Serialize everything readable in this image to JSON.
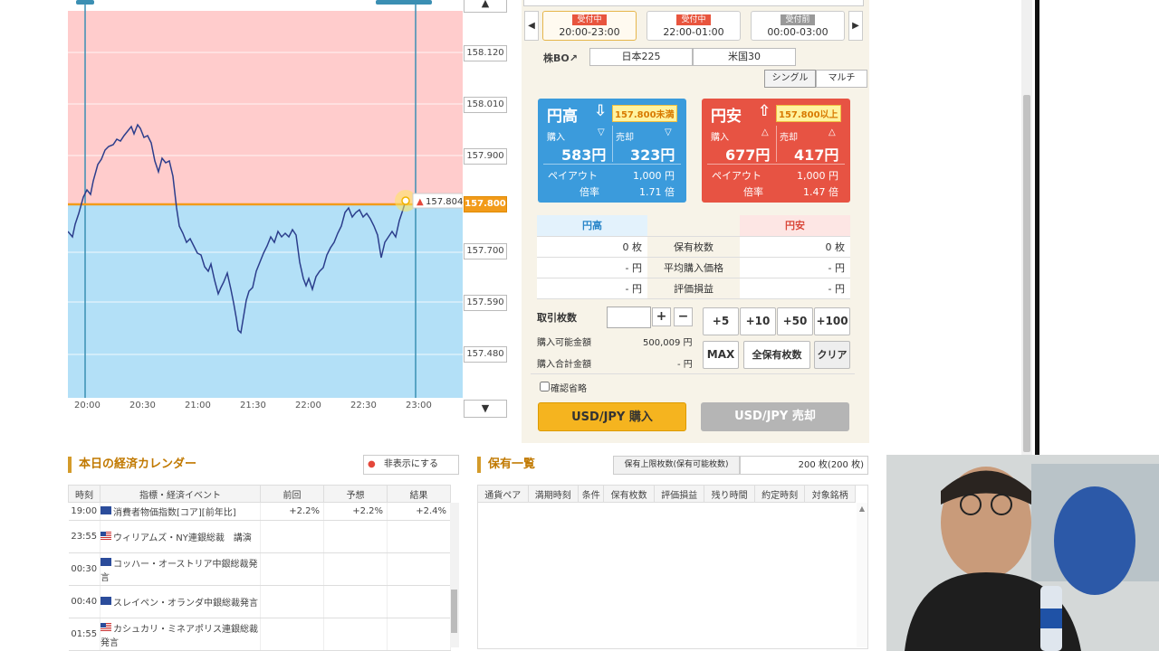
{
  "chart": {
    "price_labels": [
      "158.120",
      "158.010",
      "157.900",
      "157.800",
      "157.700",
      "157.590",
      "157.480"
    ],
    "current_price_label": "157.800",
    "marker_price": "157.804",
    "time_labels": [
      "20:00",
      "20:30",
      "21:00",
      "21:30",
      "22:00",
      "22:30",
      "23:00"
    ],
    "scroll_up": "▲",
    "scroll_down": "▼",
    "colors": {
      "upper_zone": "#ffcccc",
      "lower_zone": "#b3e0f7",
      "line": "#2c3e8c",
      "strike": "#f29b1a"
    }
  },
  "periods": {
    "prev": "◀",
    "next": "▶",
    "tabs": [
      {
        "badge": "受付中",
        "time": "20:00-23:00"
      },
      {
        "badge": "受付中",
        "time": "22:00-01:00"
      },
      {
        "badge": "受付前",
        "time": "00:00-03:00"
      }
    ]
  },
  "stock_bo": {
    "label": "株BO↗",
    "options": [
      "日本225",
      "米国30"
    ]
  },
  "mode": {
    "single": "シングル",
    "multi": "マルチ"
  },
  "yen_high": {
    "title": "円高",
    "arrow": "⇩",
    "condition": "157.800未満",
    "buy_label": "購入",
    "buy_price": "583円",
    "sell_label": "売却",
    "sell_price": "323円",
    "payout_label": "ペイアウト",
    "payout": "1,000 円",
    "rate_label": "倍率",
    "rate": "1.71 倍"
  },
  "yen_low": {
    "title": "円安",
    "arrow": "⇧",
    "condition": "157.800以上",
    "buy_label": "購入",
    "buy_price": "677円",
    "sell_label": "売却",
    "sell_price": "417円",
    "payout_label": "ペイアウト",
    "payout": "1,000 円",
    "rate_label": "倍率",
    "rate": "1.47 倍"
  },
  "positions": {
    "header_high": "円高",
    "header_low": "円安",
    "rows": [
      {
        "label": "保有枚数",
        "high": "0 枚",
        "low": "0 枚"
      },
      {
        "label": "平均購入価格",
        "high": "- 円",
        "low": "- 円"
      },
      {
        "label": "評価損益",
        "high": "- 円",
        "low": "- 円"
      }
    ]
  },
  "order": {
    "qty_label": "取引枚数",
    "plus": "+",
    "minus": "−",
    "quick": [
      "+5",
      "+10",
      "+50",
      "+100"
    ],
    "max": "MAX",
    "all_holdings": "全保有枚数",
    "clear": "クリア",
    "available_label": "購入可能金額",
    "available": "500,009 円",
    "total_label": "購入合計金額",
    "total": "- 円",
    "skip_confirm": "確認省略",
    "buy_button": "USD/JPY 購入",
    "sell_button": "USD/JPY 売却"
  },
  "calendar": {
    "title": "本日の経済カレンダー",
    "hide_button": "非表示にする",
    "columns": [
      "時刻",
      "指標・経済イベント",
      "前回",
      "予想",
      "結果"
    ],
    "rows": [
      {
        "time": "19:00",
        "flag": "eu",
        "event": "消費者物価指数[コア][前年比]",
        "prev": "+2.2%",
        "forecast": "+2.2%",
        "result": "+2.4%"
      },
      {
        "time": "23:55",
        "flag": "us",
        "event": "ウィリアムズ・NY連銀総裁　講演",
        "prev": "",
        "forecast": "",
        "result": ""
      },
      {
        "time": "00:30",
        "flag": "eu",
        "event": "コッハー・オーストリア中銀総裁発言",
        "prev": "",
        "forecast": "",
        "result": ""
      },
      {
        "time": "00:40",
        "flag": "eu",
        "event": "スレイペン・オランダ中銀総裁発言",
        "prev": "",
        "forecast": "",
        "result": ""
      },
      {
        "time": "01:55",
        "flag": "us",
        "event": "カシュカリ・ミネアポリス連銀総裁　発言",
        "prev": "",
        "forecast": "",
        "result": ""
      }
    ]
  },
  "holdings": {
    "title": "保有一覧",
    "limit_label": "保有上限枚数(保有可能枚数)",
    "limit_value": "200 枚(200 枚)",
    "columns": [
      "通貨ペア",
      "満期時刻",
      "条件",
      "保有枚数",
      "評価損益",
      "残り時間",
      "約定時刻",
      "対象銘柄"
    ]
  }
}
